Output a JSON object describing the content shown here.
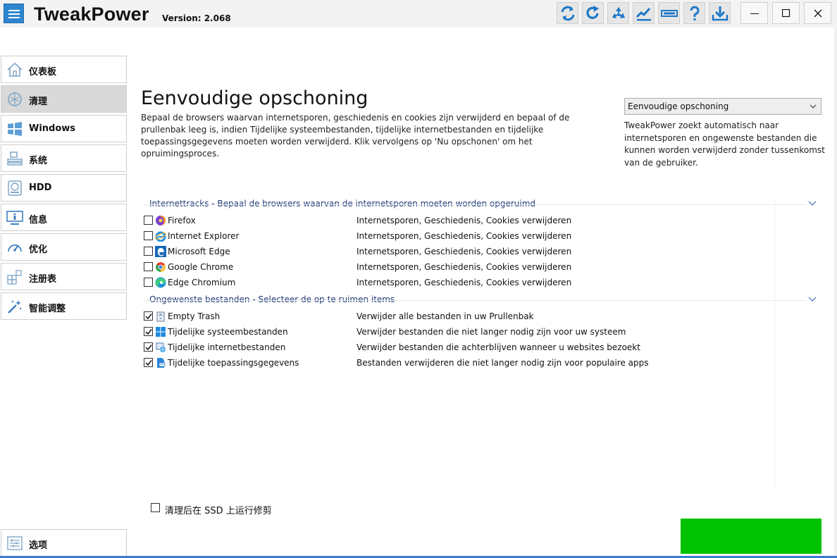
{
  "app": {
    "title": "TweakPower",
    "version": "Version: 2.068"
  },
  "toolbar": {
    "icons": [
      "refresh-icon",
      "redo-icon",
      "recycle-icon",
      "chart-line-icon",
      "battery-bar-icon",
      "help-question-icon",
      "download-icon"
    ]
  },
  "window_controls": [
    "minimize-icon",
    "maximize-icon",
    "close-icon"
  ],
  "sidebar": {
    "items": [
      {
        "label": "仪表板",
        "icon": "home-icon"
      },
      {
        "label": "清理",
        "icon": "clean-icon",
        "active": true
      },
      {
        "label": "Windows",
        "icon": "windows-logo-icon"
      },
      {
        "label": "系统",
        "icon": "system-icon"
      },
      {
        "label": "HDD",
        "icon": "hdd-icon"
      },
      {
        "label": "信息",
        "icon": "monitor-info-icon"
      },
      {
        "label": "优化",
        "icon": "speedometer-icon"
      },
      {
        "label": "注册表",
        "icon": "registry-icon"
      },
      {
        "label": "智能调整",
        "icon": "magic-wand-icon"
      }
    ],
    "options": {
      "label": "选项",
      "icon": "options-list-icon"
    }
  },
  "main": {
    "title": "Eenvoudige opschoning",
    "intro": "Bepaal de browsers waarvan internetsporen, geschiedenis en cookies zijn verwijderd en bepaal of de prullenbak leeg is, indien Tijdelijke systeembestanden, tijdelijke internetbestanden en tijdelijke toepassingsgegevens moeten worden verwijderd. Klik vervolgens op 'Nu opschonen' om het opruimingsproces.",
    "mode_select": {
      "value": "Eenvoudige opschoning"
    },
    "mode_description": "TweakPower zoekt automatisch naar internetsporen en ongewenste bestanden die kunnen worden verwijderd zonder tussenkomst van de gebruiker.",
    "groups": [
      {
        "title": "Internettracks - Bepaal de browsers waarvan de internetsporen moeten worden opgeruimd",
        "items": [
          {
            "name": "Firefox",
            "desc": "Internetsporen, Geschiedenis, Cookies verwijderen",
            "checked": false,
            "icon": "firefox-icon"
          },
          {
            "name": "Internet Explorer",
            "desc": "Internetsporen, Geschiedenis, Cookies verwijderen",
            "checked": false,
            "icon": "internet-explorer-icon"
          },
          {
            "name": "Microsoft Edge",
            "desc": "Internetsporen, Geschiedenis, Cookies verwijderen",
            "checked": false,
            "icon": "edge-legacy-icon"
          },
          {
            "name": "Google Chrome",
            "desc": "Internetsporen, Geschiedenis, Cookies verwijderen",
            "checked": false,
            "icon": "chrome-icon"
          },
          {
            "name": "Edge Chromium",
            "desc": "Internetsporen, Geschiedenis, Cookies verwijderen",
            "checked": false,
            "icon": "edge-chromium-icon"
          }
        ]
      },
      {
        "title": "Ongewenste bestanden - Selecteer de op te ruimen items",
        "items": [
          {
            "name": "Empty Trash",
            "desc": "Verwijder alle bestanden in uw Prullenbak",
            "checked": true,
            "icon": "trash-icon"
          },
          {
            "name": "Tijdelijke systeembestanden",
            "desc": "Verwijder bestanden die niet langer nodig zijn voor uw systeem",
            "checked": true,
            "icon": "windows-logo-icon"
          },
          {
            "name": "Tijdelijke internetbestanden",
            "desc": "Verwijder bestanden die achterblijven wanneer u websites bezoekt",
            "checked": true,
            "icon": "internet-files-icon"
          },
          {
            "name": "Tijdelijke toepassingsgegevens",
            "desc": "Bestanden verwijderen die niet langer nodig zijn voor populaire apps",
            "checked": true,
            "icon": "app-data-icon"
          }
        ]
      }
    ],
    "ssd_trim": {
      "label": "清理后在 SSD 上运行修剪",
      "checked": false
    }
  },
  "colors": {
    "accent": "#2e86cf",
    "group_heading": "#1e3a78",
    "action_green": "#00c200",
    "active_nav": "#d9d9d9"
  }
}
